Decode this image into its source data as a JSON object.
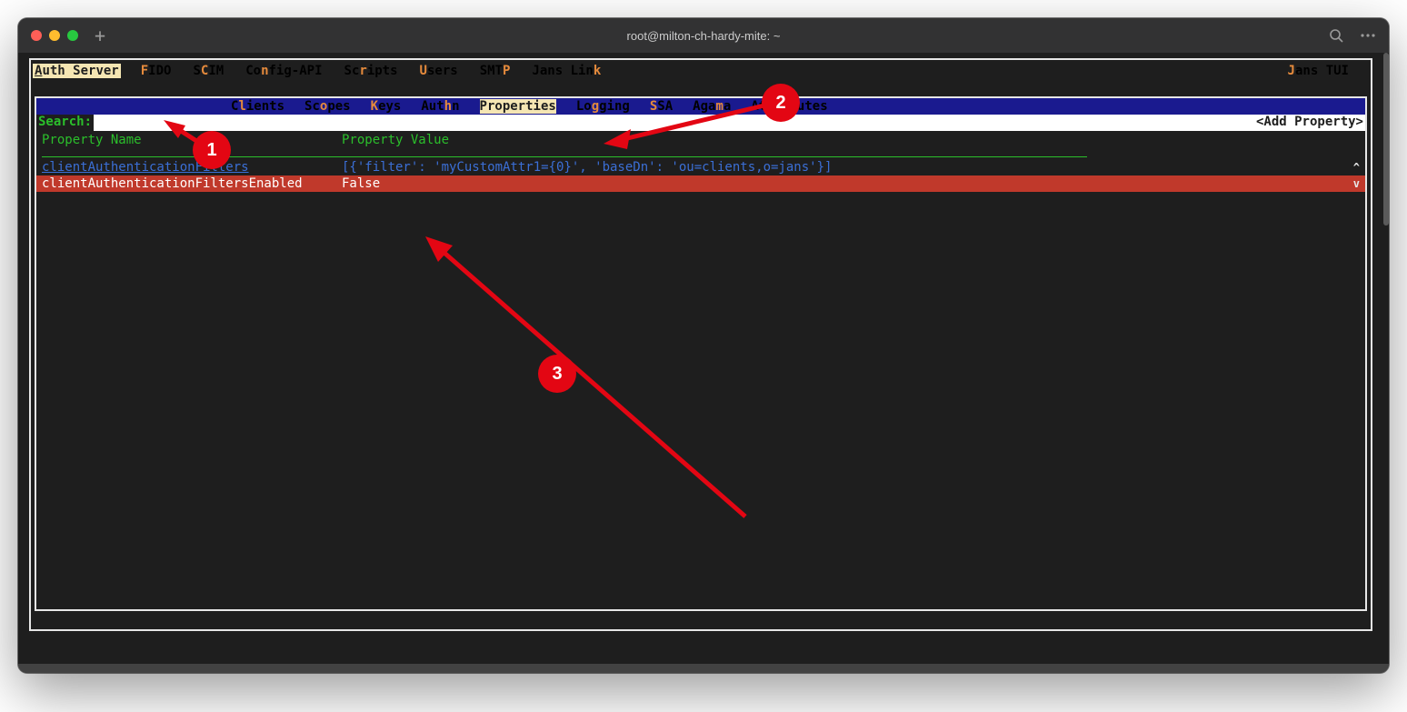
{
  "window": {
    "title": "root@milton-ch-hardy-mite: ~"
  },
  "menubar": {
    "items": [
      {
        "pre": "",
        "hot": "A",
        "post": "uth Server",
        "selected": true
      },
      {
        "pre": "",
        "hot": "F",
        "post": "IDO"
      },
      {
        "pre": "S",
        "hot": "C",
        "post": "IM"
      },
      {
        "pre": "Co",
        "hot": "n",
        "post": "fig-API"
      },
      {
        "pre": "Sc",
        "hot": "r",
        "post": "ipts"
      },
      {
        "pre": "",
        "hot": "U",
        "post": "sers"
      },
      {
        "pre": "SMT",
        "hot": "P",
        "post": ""
      },
      {
        "pre": "Jans Lin",
        "hot": "k",
        "post": ""
      }
    ],
    "brand": {
      "pre": "",
      "hot": "J",
      "post": "ans TUI"
    }
  },
  "tabs": [
    {
      "pre": "C",
      "hot": "l",
      "post": "ients"
    },
    {
      "pre": "Sc",
      "hot": "o",
      "post": "pes"
    },
    {
      "pre": "",
      "hot": "K",
      "post": "eys"
    },
    {
      "pre": "Aut",
      "hot": "h",
      "post": "n"
    },
    {
      "pre": "Properti",
      "hot": "e",
      "post": "s",
      "selected": true
    },
    {
      "pre": "Lo",
      "hot": "g",
      "post": "ging"
    },
    {
      "pre": "",
      "hot": "S",
      "post": "SA"
    },
    {
      "pre": "Aga",
      "hot": "m",
      "post": "a"
    },
    {
      "pre": "Attri",
      "hot": "b",
      "post": "utes"
    }
  ],
  "search": {
    "label": "Search:",
    "value": "",
    "add_button": "<Add Property>"
  },
  "table": {
    "col_name": "Property Name",
    "col_value": "Property Value",
    "rows": [
      {
        "name": "clientAuthenticationFilters",
        "value": "[{'filter': 'myCustomAttr1={0}', 'baseDn': 'ou=clients,o=jans'}]",
        "kind": "link"
      },
      {
        "name": "clientAuthenticationFiltersEnabled",
        "value": "False",
        "kind": "selected"
      }
    ],
    "scroll_up": "^",
    "scroll_down": "v"
  },
  "annotations": {
    "b1": "1",
    "b2": "2",
    "b3": "3"
  }
}
